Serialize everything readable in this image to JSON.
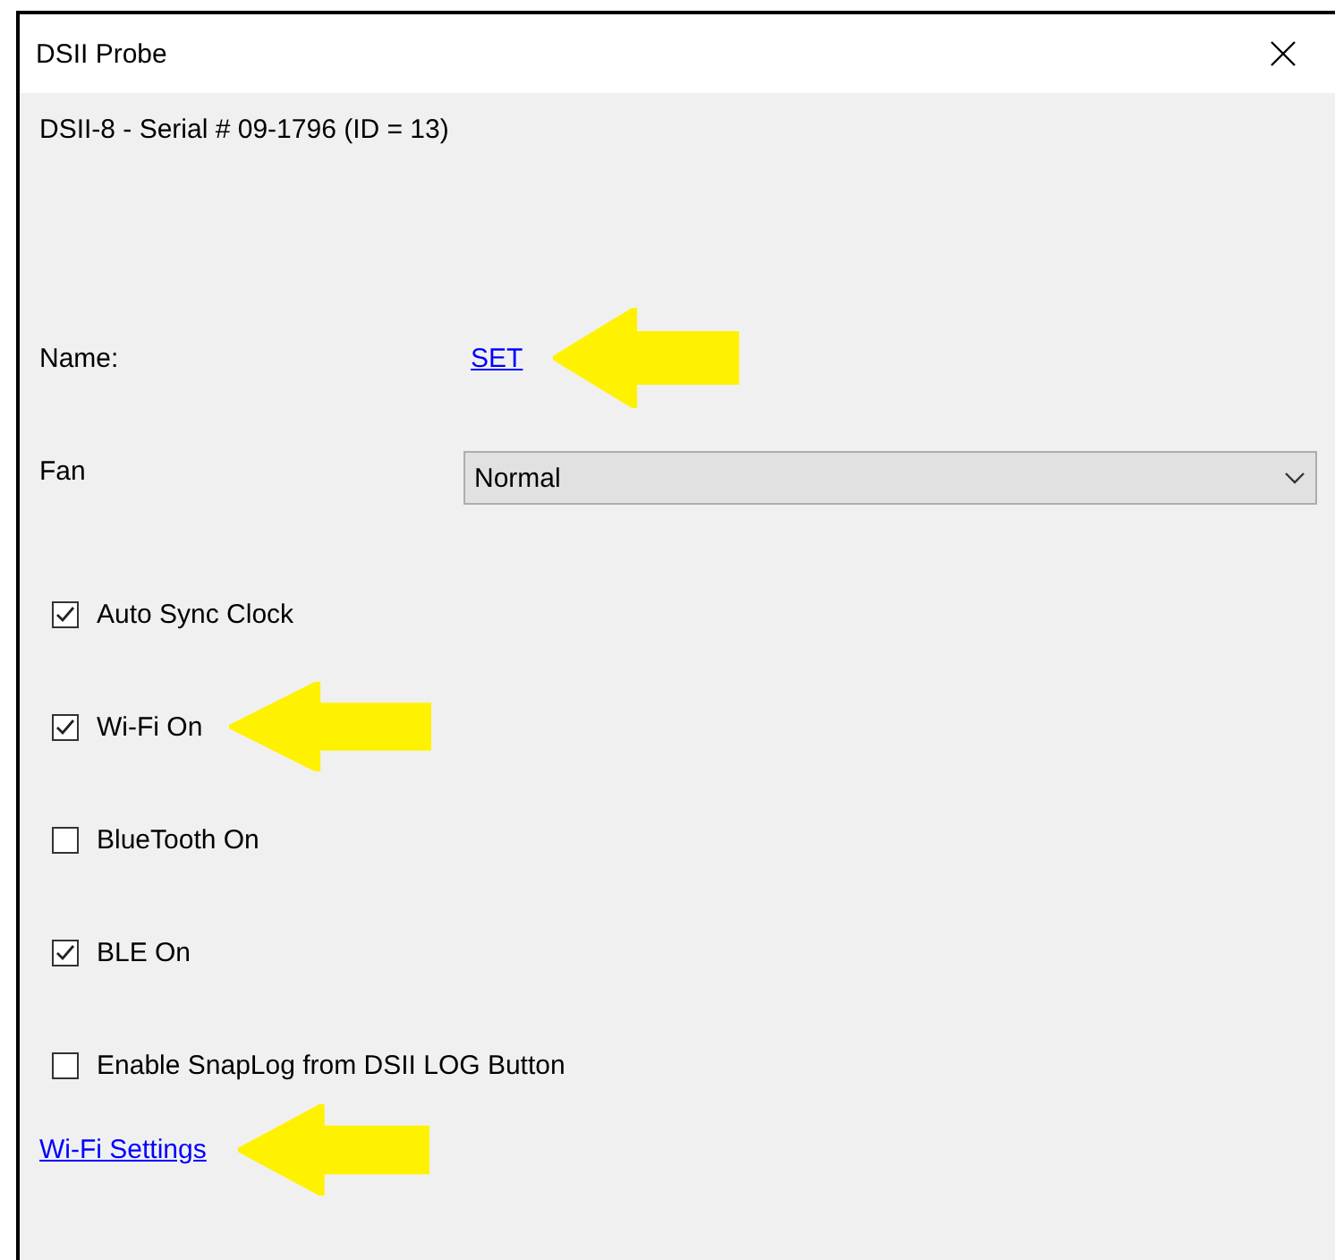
{
  "window": {
    "title": "DSII Probe"
  },
  "device_line": "DSII-8 - Serial # 09-1796 (ID = 13)",
  "name_field": {
    "label": "Name:",
    "link": "SET",
    "annotated": true
  },
  "fan": {
    "label": "Fan",
    "value": "Normal"
  },
  "checkboxes": [
    {
      "label": "Auto Sync Clock",
      "checked": true,
      "annotated": false
    },
    {
      "label": "Wi-Fi On",
      "checked": true,
      "annotated": true
    },
    {
      "label": "BlueTooth On",
      "checked": false,
      "annotated": false
    },
    {
      "label": "BLE On",
      "checked": true,
      "annotated": false
    },
    {
      "label": "Enable SnapLog from DSII LOG Button",
      "checked": false,
      "annotated": false
    }
  ],
  "wifi_settings_link": {
    "label": "Wi-Fi Settings",
    "annotated": true
  }
}
